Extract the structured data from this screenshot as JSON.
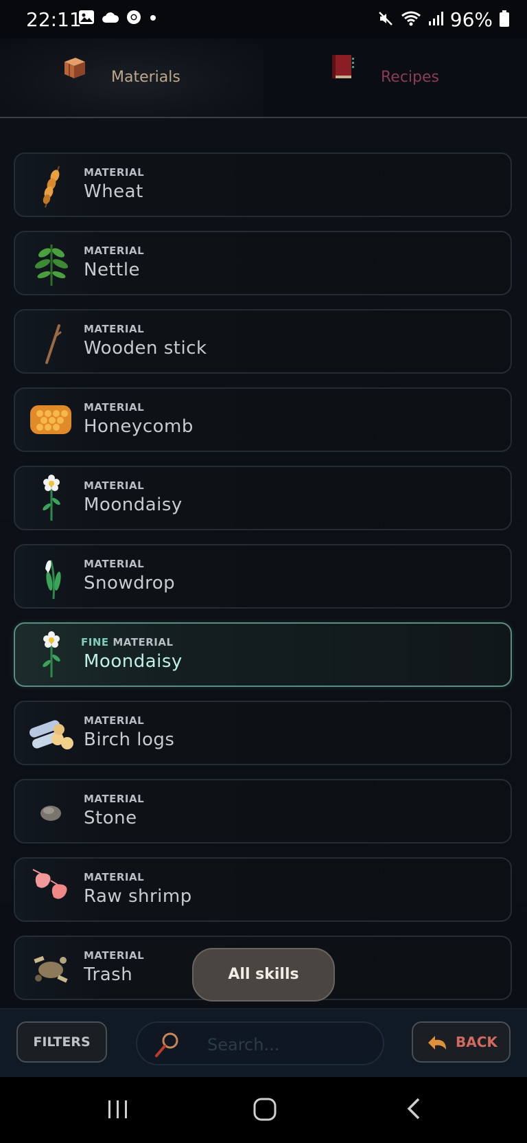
{
  "status_bar": {
    "time": "22:11",
    "battery": "96%",
    "icons": [
      "image-icon",
      "cloud-icon",
      "chrome-icon",
      "dot-icon",
      "mute-icon",
      "wifi-icon",
      "signal-icon",
      "battery-icon"
    ]
  },
  "tabs": [
    {
      "label": "Materials",
      "icon": "crate-icon",
      "active": true
    },
    {
      "label": "Recipes",
      "icon": "book-icon",
      "active": false
    }
  ],
  "items": [
    {
      "type": "MATERIAL",
      "name": "Wheat",
      "icon": "wheat-icon"
    },
    {
      "type": "MATERIAL",
      "name": "Nettle",
      "icon": "nettle-icon"
    },
    {
      "type": "MATERIAL",
      "name": "Wooden stick",
      "icon": "stick-icon"
    },
    {
      "type": "MATERIAL",
      "name": "Honeycomb",
      "icon": "honeycomb-icon"
    },
    {
      "type": "MATERIAL",
      "name": "Moondaisy",
      "icon": "daisy-icon"
    },
    {
      "type": "MATERIAL",
      "name": "Snowdrop",
      "icon": "snowdrop-icon"
    },
    {
      "type_prefix": "FINE",
      "type": "MATERIAL",
      "name": "Moondaisy",
      "icon": "daisy-icon",
      "fine": true
    },
    {
      "type": "MATERIAL",
      "name": "Birch logs",
      "icon": "logs-icon"
    },
    {
      "type": "MATERIAL",
      "name": "Stone",
      "icon": "stone-icon"
    },
    {
      "type": "MATERIAL",
      "name": "Raw shrimp",
      "icon": "shrimp-icon"
    },
    {
      "type": "MATERIAL",
      "name": "Trash",
      "icon": "trash-icon"
    }
  ],
  "skills_pill": {
    "label": "All skills"
  },
  "bottom_bar": {
    "filters_label": "FILTERS",
    "search_placeholder": "Search...",
    "search_value": "",
    "back_label": "BACK"
  },
  "colors": {
    "background": "#0c1118",
    "fine_accent": "#7fcbbd",
    "back_accent": "#d06a60",
    "materials_tab": "#bfa78a",
    "recipes_tab": "#8a3b55"
  }
}
